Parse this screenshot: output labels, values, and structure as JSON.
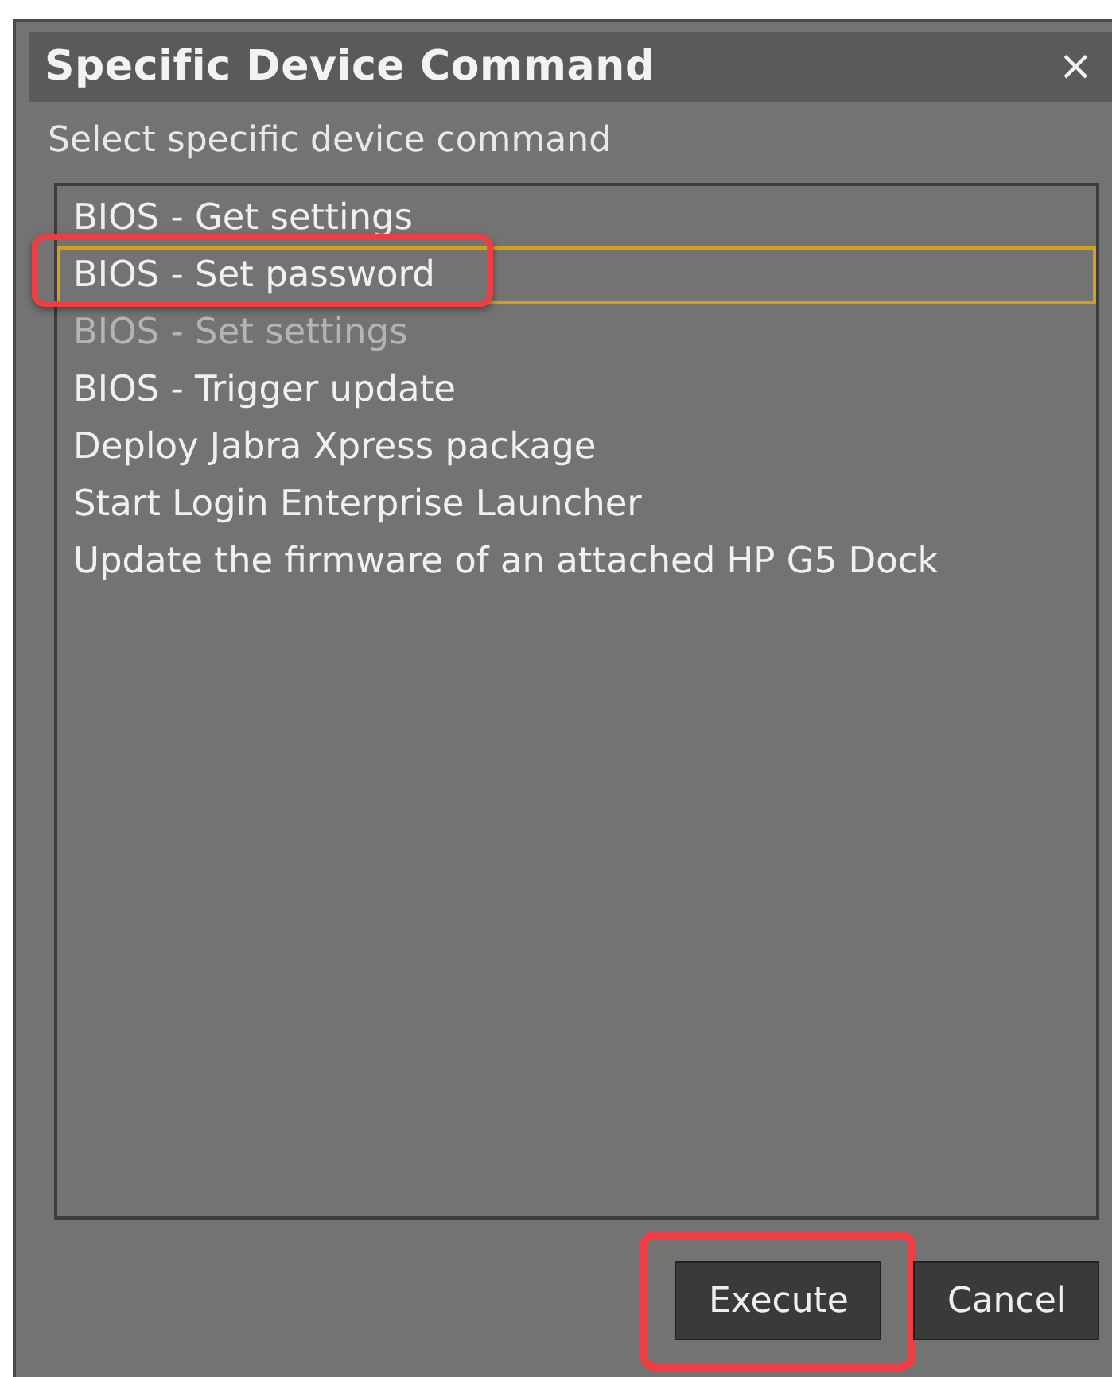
{
  "dialog": {
    "title": "Specific Device Command",
    "close": "×",
    "prompt": "Select specific device command",
    "commands": [
      {
        "label": "BIOS - Get settings",
        "selected": false,
        "highlighted": false
      },
      {
        "label": "BIOS - Set password",
        "selected": true,
        "highlighted": true
      },
      {
        "label": "BIOS - Set settings",
        "selected": false,
        "highlighted": false
      },
      {
        "label": "BIOS - Trigger update",
        "selected": false,
        "highlighted": false
      },
      {
        "label": "Deploy Jabra Xpress package",
        "selected": false,
        "highlighted": false
      },
      {
        "label": "Start Login Enterprise Launcher",
        "selected": false,
        "highlighted": false
      },
      {
        "label": "Update the firmware of an attached HP G5 Dock",
        "selected": false,
        "highlighted": false
      }
    ],
    "buttons": [
      {
        "label": "Execute",
        "highlighted": true
      },
      {
        "label": "Cancel",
        "highlighted": false
      }
    ]
  }
}
